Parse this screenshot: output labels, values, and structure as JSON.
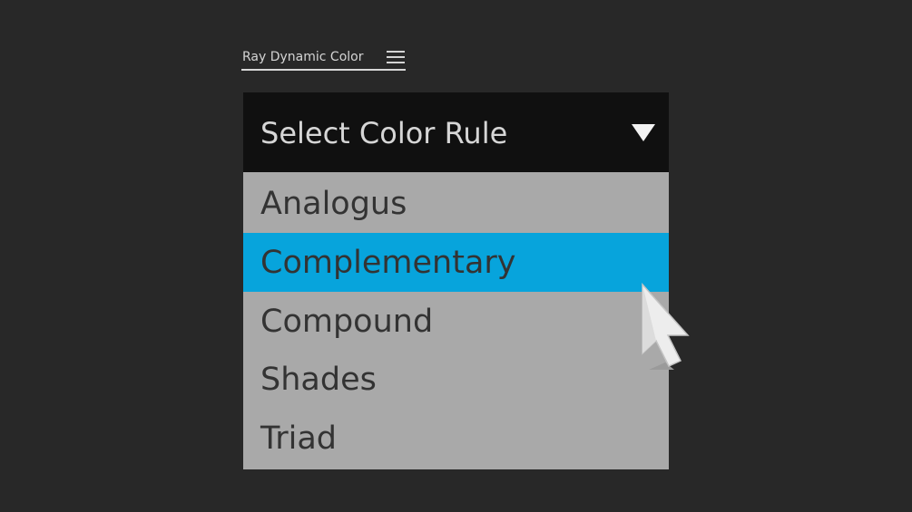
{
  "panel": {
    "title": "Ray Dynamic Color",
    "menu_icon": "hamburger-menu-icon"
  },
  "dropdown": {
    "label": "Select Color Rule",
    "caret_icon": "triangle-down-icon",
    "options": [
      {
        "label": "Analogus",
        "selected": false
      },
      {
        "label": "Complementary",
        "selected": true
      },
      {
        "label": "Compound",
        "selected": false
      },
      {
        "label": "Shades",
        "selected": false
      },
      {
        "label": "Triad",
        "selected": false
      }
    ]
  },
  "cursor": {
    "icon": "arrow-pointer-icon"
  },
  "colors": {
    "background": "#282828",
    "header": "#101010",
    "list": "#a9a9a9",
    "selected": "#07a4dc",
    "option_text": "#333333",
    "header_text": "#d6d6d6"
  }
}
